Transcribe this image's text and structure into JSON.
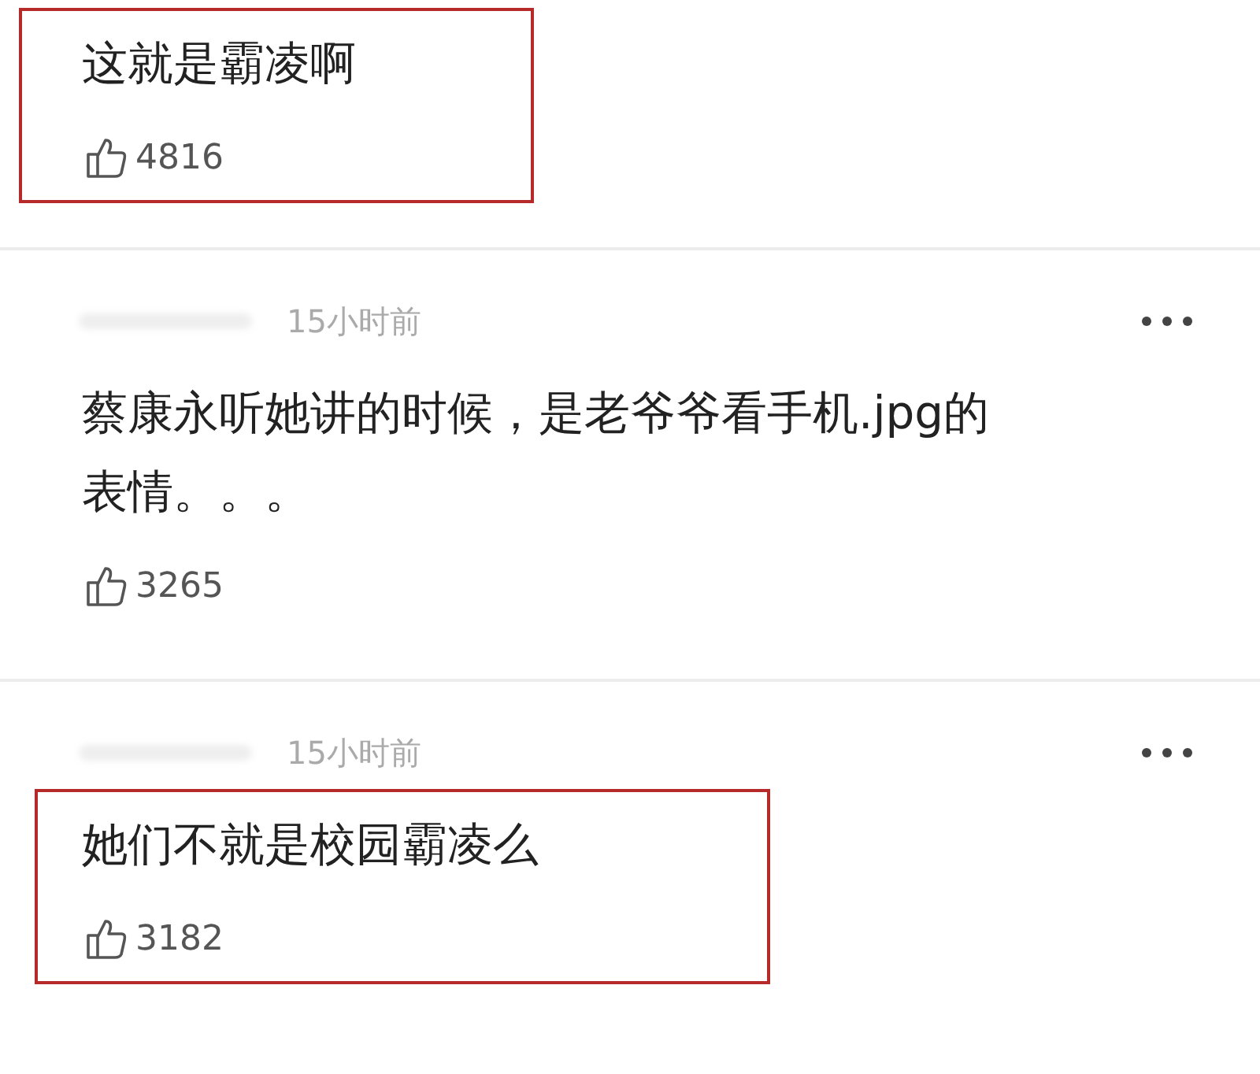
{
  "comments": [
    {
      "text": "这就是霸凌啊",
      "likes": "4816",
      "highlighted": true
    },
    {
      "time": "15小时前",
      "text": "蔡康永听她讲的时候，是老爷爷看手机.jpg的表情。。。",
      "likes": "3265",
      "highlighted": false
    },
    {
      "time": "15小时前",
      "text": "她们不就是校园霸凌么",
      "likes": "3182",
      "highlighted": true
    }
  ]
}
